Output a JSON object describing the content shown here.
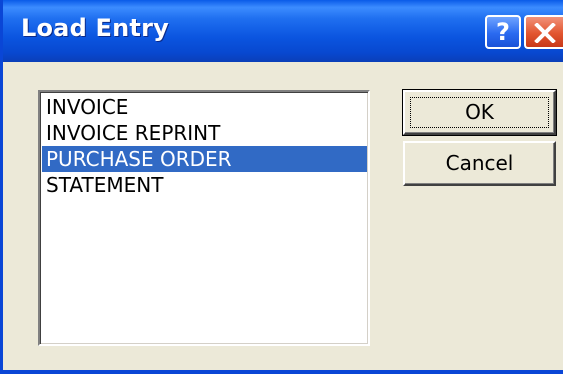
{
  "window": {
    "title": "Load Entry",
    "help_symbol": "?"
  },
  "icons": {
    "help": "help-icon",
    "close": "close-icon"
  },
  "listbox": {
    "items": [
      "INVOICE",
      "INVOICE REPRINT",
      "PURCHASE ORDER",
      "STATEMENT"
    ],
    "selected": "PURCHASE ORDER"
  },
  "buttons": {
    "ok_label": "OK",
    "cancel_label": "Cancel"
  },
  "colors": {
    "titlebar": "#0a5be8",
    "selection": "#316ac5",
    "dialog_face": "#ece9d8",
    "close_button": "#e2552f"
  }
}
